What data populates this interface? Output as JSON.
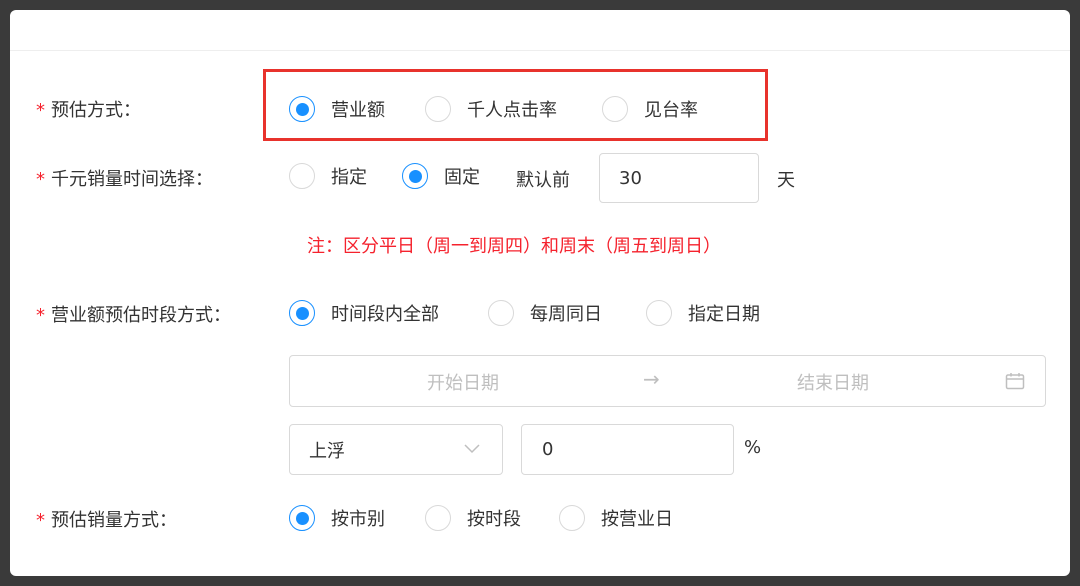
{
  "form": {
    "estimate_method": {
      "required_mark": "*",
      "label": "预估方式：",
      "options": [
        {
          "label": "营业额",
          "checked": true
        },
        {
          "label": "千人点击率",
          "checked": false
        },
        {
          "label": "见台率",
          "checked": false
        }
      ]
    },
    "time_select": {
      "required_mark": "*",
      "label": "千元销量时间选择：",
      "options": [
        {
          "label": "指定",
          "checked": false
        },
        {
          "label": "固定",
          "checked": true
        }
      ],
      "default_prefix": "默认前",
      "days_value": "30",
      "days_unit": "天",
      "note": "注：区分平日（周一到周四）和周末（周五到周日）"
    },
    "period_method": {
      "required_mark": "*",
      "label": "营业额预估时段方式：",
      "options": [
        {
          "label": "时间段内全部",
          "checked": true
        },
        {
          "label": "每周同日",
          "checked": false
        },
        {
          "label": "指定日期",
          "checked": false
        }
      ],
      "date_range": {
        "start_placeholder": "开始日期",
        "separator": "→",
        "end_placeholder": "结束日期",
        "icon": "calendar-icon"
      },
      "float_select": {
        "value": "上浮",
        "icon": "chevron-down-icon"
      },
      "percent_value": "0",
      "percent_unit": "%"
    },
    "sales_method": {
      "required_mark": "*",
      "label": "预估销量方式：",
      "options": [
        {
          "label": "按市别",
          "checked": true
        },
        {
          "label": "按时段",
          "checked": false
        },
        {
          "label": "按营业日",
          "checked": false
        }
      ]
    }
  },
  "colors": {
    "primary": "#1890ff",
    "required": "#f5222d",
    "highlight_box": "#e8322c",
    "placeholder": "#bfbfbf"
  }
}
